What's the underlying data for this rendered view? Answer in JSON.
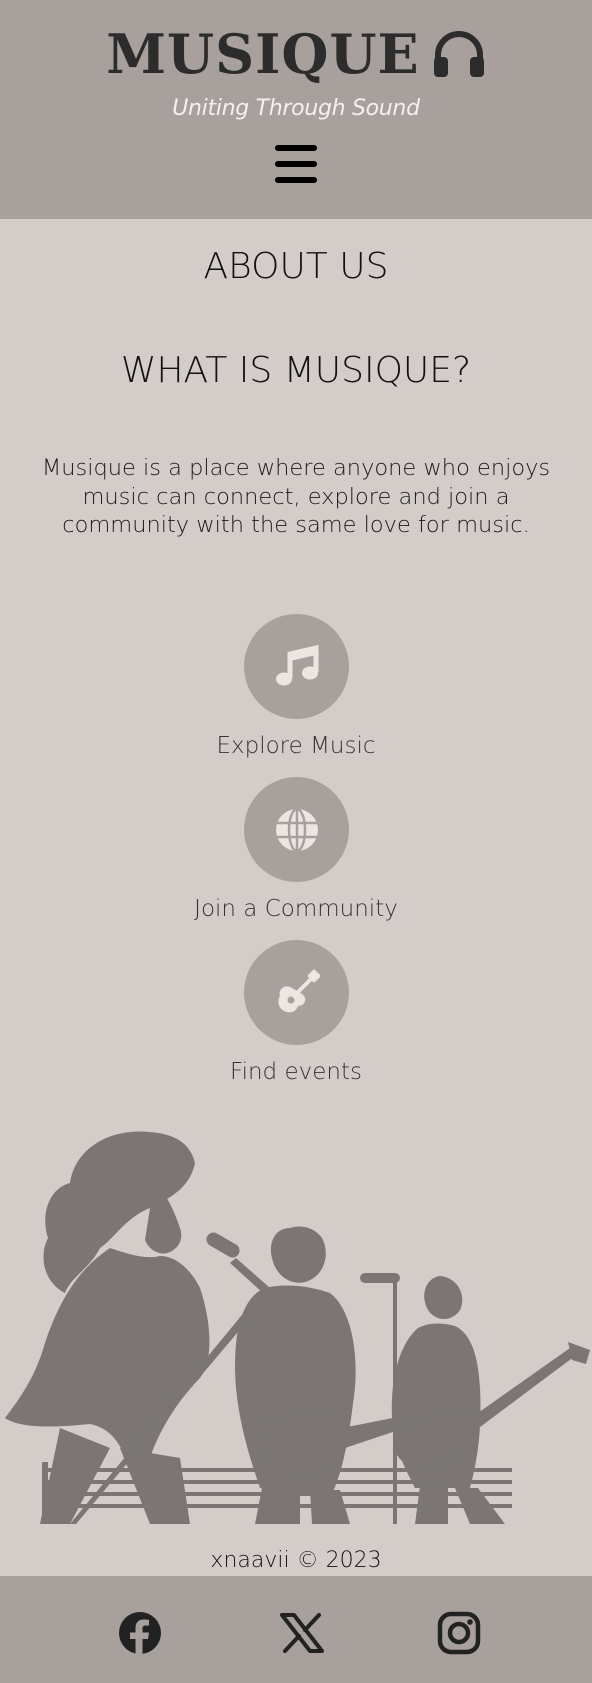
{
  "header": {
    "logo_text": "MUSIQUE",
    "logo_icon": "headphones-icon",
    "tagline": "Uniting Through Sound",
    "menu_icon": "hamburger-menu-icon"
  },
  "about": {
    "heading": "ABOUT US",
    "subheading": "WHAT IS MUSIQUE?",
    "description": "Musique is a place where anyone who enjoys music can connect, explore and join a community with the same love for music."
  },
  "features": [
    {
      "label": "Explore Music",
      "icon": "music-note-icon"
    },
    {
      "label": "Join a Community",
      "icon": "globe-icon"
    },
    {
      "label": "Find events",
      "icon": "guitar-icon"
    }
  ],
  "illustration": {
    "icon": "band-illustration"
  },
  "footer": {
    "copyright": "xnaavii © 2023",
    "social": [
      {
        "icon": "facebook-icon"
      },
      {
        "icon": "x-twitter-icon"
      },
      {
        "icon": "instagram-icon"
      }
    ]
  },
  "colors": {
    "background": "#d4ccc8",
    "header_bg": "#a8a09c",
    "circle_bg": "#a8a09c",
    "logo_color": "#2d2c2c",
    "illustration": "#7b7673"
  }
}
